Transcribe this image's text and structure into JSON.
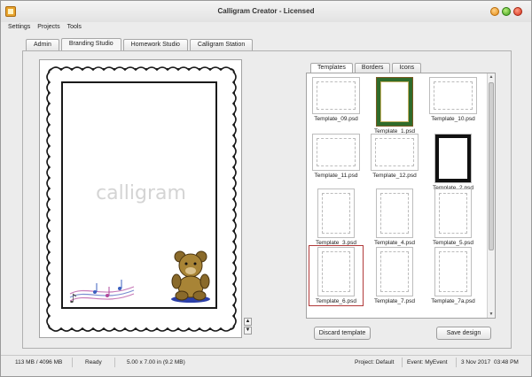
{
  "window": {
    "title": "Calligram Creator - Licensed"
  },
  "menu": [
    "Settings",
    "Projects",
    "Tools"
  ],
  "tabs": [
    "Admin",
    "Branding Studio",
    "Homework Studio",
    "Calligram Station"
  ],
  "canvas": {
    "watermark": "calligram"
  },
  "panel_tabs": [
    "Templates",
    "Borders",
    "Icons"
  ],
  "templates": [
    {
      "name": "Template_09.psd",
      "shape": "land"
    },
    {
      "name": "Template_1.psd",
      "shape": "port",
      "style": "green"
    },
    {
      "name": "Template_10.psd",
      "shape": "land"
    },
    {
      "name": "Template_11.psd",
      "shape": "land"
    },
    {
      "name": "Template_12.psd",
      "shape": "land"
    },
    {
      "name": "Template_2.psd",
      "shape": "port",
      "style": "black"
    },
    {
      "name": "Template_3.psd",
      "shape": "port"
    },
    {
      "name": "Template_4.psd",
      "shape": "port"
    },
    {
      "name": "Template_5.psd",
      "shape": "port"
    },
    {
      "name": "Template_6.psd",
      "shape": "port",
      "selected": true
    },
    {
      "name": "Template_7.psd",
      "shape": "port"
    },
    {
      "name": "Template_7a.psd",
      "shape": "port"
    }
  ],
  "buttons": {
    "discard": "Discard template",
    "save": "Save design"
  },
  "status": {
    "memory": "113 MB / 4096 MB",
    "state": "Ready",
    "size": "5.00 x 7.00 in (9.2 MB)",
    "project": "Project: Default",
    "event": "Event: MyEvent",
    "date": "3 Nov 2017",
    "time": "03:48 PM"
  }
}
